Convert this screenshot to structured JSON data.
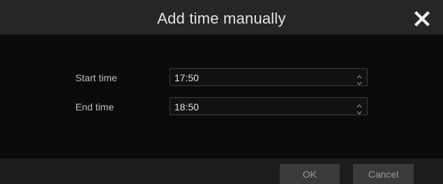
{
  "dialog": {
    "title": "Add time manually",
    "close_icon": "close-icon"
  },
  "form": {
    "start": {
      "label": "Start time",
      "value": "17:50"
    },
    "end": {
      "label": "End time",
      "value": "18:50"
    }
  },
  "footer": {
    "ok_label": "OK",
    "cancel_label": "Cancel"
  },
  "colors": {
    "title_bar": "#262626",
    "body": "#0a0a0a",
    "footer": "#1c1c1c",
    "button": "#3a3a3a",
    "field_border": "#3c3c3c"
  }
}
